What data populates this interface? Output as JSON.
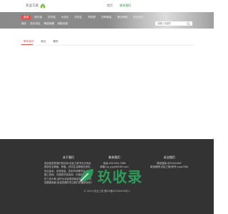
{
  "header": {
    "logo_text": "农业工具",
    "links": [
      "首页",
      "联系我们"
    ],
    "active_link": "联系我们"
  },
  "nav": {
    "items": [
      "首页",
      "新手指",
      "农村组",
      "大农区",
      "农机区",
      "有机肥",
      "四季植保",
      "渔业养殖",
      "农业资讯"
    ],
    "active_index": 0
  },
  "subnav": {
    "items": [
      "我业",
      "农业论坛",
      "网站投稿",
      "网站动态"
    ]
  },
  "search": {
    "placeholder": "请输入关键字"
  },
  "tabs": {
    "items": [
      "联系我们",
      "商业",
      "服务"
    ],
    "active_index": 0
  },
  "footer": {
    "about": {
      "title": "关于我们",
      "text": "农民致富是我们的目标!农民之家专业为农民提供农业种植、养殖、农村生活等相关资讯,农业技术、农资信息、农机市场等内容,为中国三农网、中国农村信息网、中国农民网、农村三农头条,及时为农民提供致富信息,为农村发展做贡献,欢迎您随时关注我们的最新动态!"
    },
    "contact": {
      "title": "联系我们",
      "phone": "电话:400-096-7288",
      "email": "邮箱:ng_yygs@163.com"
    },
    "follow": {
      "title": "关注我们",
      "wechat": "微信搜索:@YGX2GNY",
      "weibo": "新浪微博:农民之家(账号:yxgs788)"
    },
    "copyright": "© 2019 农业工具 蜀ICP备2019093X号-1"
  },
  "watermark": {
    "text": "玖收录"
  },
  "colors": {
    "accent": "#d9534f",
    "green": "#2b8a3e",
    "footer_bg": "#333333"
  }
}
